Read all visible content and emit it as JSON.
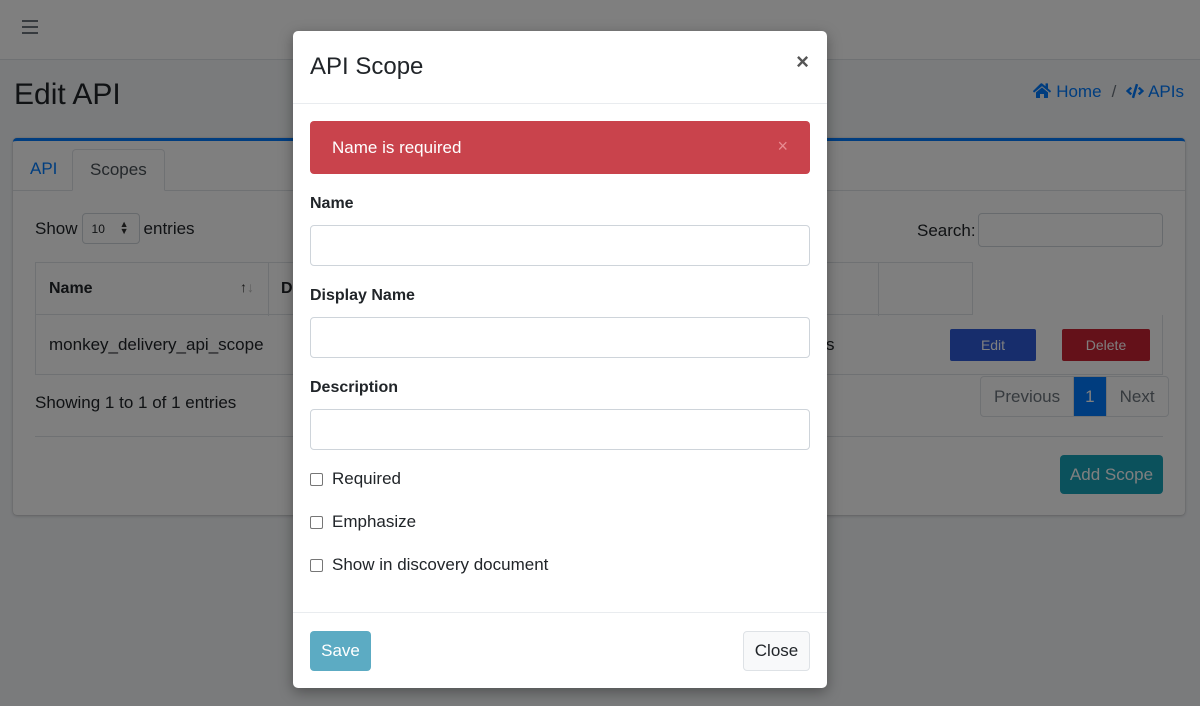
{
  "page": {
    "title": "Edit API",
    "breadcrumb": [
      {
        "label": "Home",
        "icon": "home-icon"
      },
      {
        "label": "APIs",
        "icon": "code-icon"
      }
    ],
    "breadcrumb_separator": "/"
  },
  "tabs": [
    {
      "label": "API",
      "active": false
    },
    {
      "label": "Scopes",
      "active": true
    }
  ],
  "table": {
    "show_label": "Show",
    "entries_value": "10",
    "entries_label": "entries",
    "search_label": "Search:",
    "search_value": "",
    "columns": [
      "Name",
      "D"
    ],
    "rows": [
      {
        "name": "monkey_delivery_api_scope",
        "partial_text": "s",
        "edit_label": "Edit",
        "delete_label": "Delete"
      }
    ],
    "info": "Showing 1 to 1 of 1 entries",
    "pagination": {
      "previous": "Previous",
      "current": "1",
      "next": "Next"
    },
    "add_button": "Add Scope"
  },
  "modal": {
    "title": "API Scope",
    "close_symbol": "×",
    "alert": {
      "message": "Name is required",
      "close_symbol": "×",
      "color": "#c9434c"
    },
    "fields": [
      {
        "label": "Name",
        "value": ""
      },
      {
        "label": "Display Name",
        "value": ""
      },
      {
        "label": "Description",
        "value": ""
      }
    ],
    "checkboxes": [
      {
        "label": "Required",
        "checked": false
      },
      {
        "label": "Emphasize",
        "checked": false
      },
      {
        "label": "Show in discovery document",
        "checked": false
      }
    ],
    "save_label": "Save",
    "close_label": "Close"
  },
  "colors": {
    "primary": "#007bff",
    "danger": "#c82333",
    "info": "#17a2b8"
  }
}
